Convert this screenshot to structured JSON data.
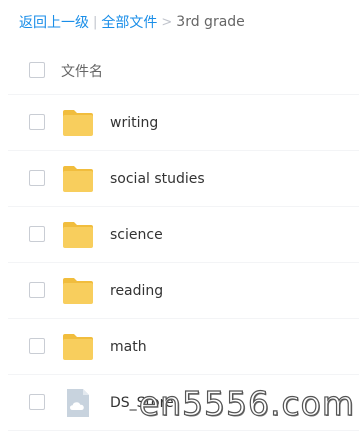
{
  "breadcrumb": {
    "back": "返回上一级",
    "separator_bar": "|",
    "all_files": "全部文件",
    "separator_arrow": ">",
    "current": "3rd grade"
  },
  "list": {
    "header": "文件名",
    "items": [
      {
        "name": "writing",
        "icon": "folder-icon"
      },
      {
        "name": "social studies",
        "icon": "folder-icon"
      },
      {
        "name": "science",
        "icon": "folder-icon"
      },
      {
        "name": "reading",
        "icon": "folder-icon"
      },
      {
        "name": "math",
        "icon": "folder-icon"
      },
      {
        "name": "DS_Store",
        "icon": "cloud-file-icon"
      }
    ]
  },
  "watermark": "en5556.com",
  "colors": {
    "link": "#1a8ee8",
    "folder": "#f8ce5d",
    "folder_tab": "#f1bd3d",
    "file": "#c8d3de"
  }
}
